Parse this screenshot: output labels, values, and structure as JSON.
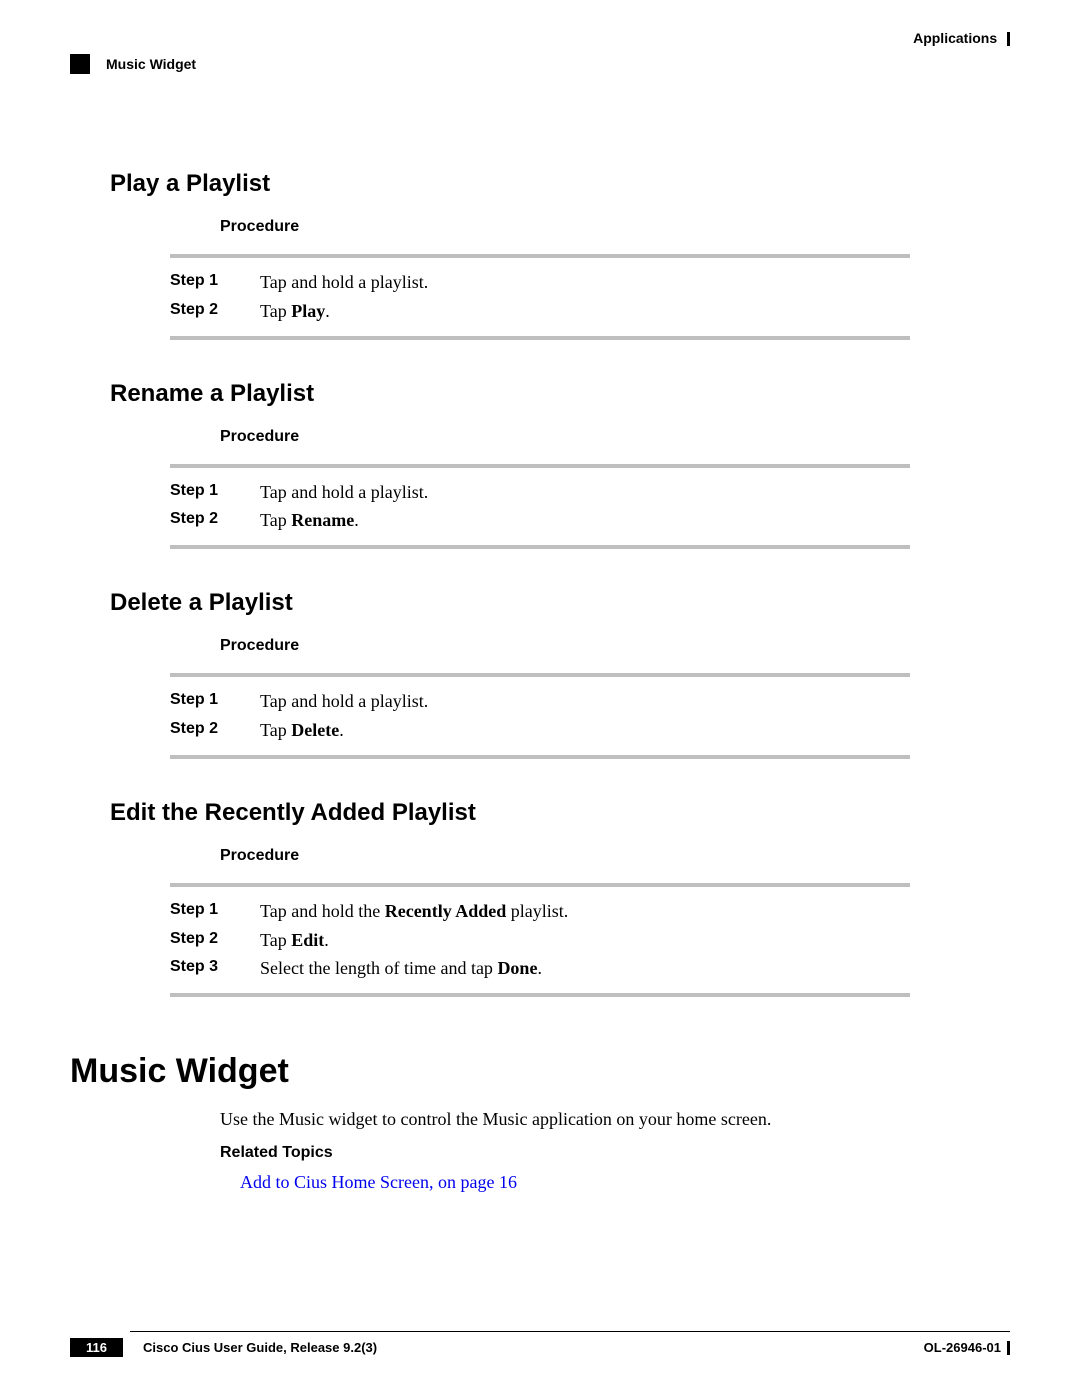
{
  "header": {
    "chapter": "Applications",
    "breadcrumb": "Music Widget"
  },
  "sections": [
    {
      "title": "Play a Playlist",
      "procedure_label": "Procedure",
      "steps": [
        {
          "label": "Step 1",
          "pre": "Tap and hold a playlist.",
          "bold": "",
          "post": ""
        },
        {
          "label": "Step 2",
          "pre": "Tap ",
          "bold": "Play",
          "post": "."
        }
      ]
    },
    {
      "title": "Rename a Playlist",
      "procedure_label": "Procedure",
      "steps": [
        {
          "label": "Step 1",
          "pre": "Tap and hold a playlist.",
          "bold": "",
          "post": ""
        },
        {
          "label": "Step 2",
          "pre": "Tap ",
          "bold": "Rename",
          "post": "."
        }
      ]
    },
    {
      "title": "Delete a Playlist",
      "procedure_label": "Procedure",
      "steps": [
        {
          "label": "Step 1",
          "pre": "Tap and hold a playlist.",
          "bold": "",
          "post": ""
        },
        {
          "label": "Step 2",
          "pre": "Tap ",
          "bold": "Delete",
          "post": "."
        }
      ]
    },
    {
      "title": "Edit the Recently Added Playlist",
      "procedure_label": "Procedure",
      "steps": [
        {
          "label": "Step 1",
          "pre": "Tap and hold the ",
          "bold": "Recently Added",
          "post": " playlist."
        },
        {
          "label": "Step 2",
          "pre": "Tap ",
          "bold": "Edit",
          "post": "."
        },
        {
          "label": "Step 3",
          "pre": "Select the length of time and tap ",
          "bold": "Done",
          "post": "."
        }
      ]
    }
  ],
  "widget": {
    "heading": "Music Widget",
    "body": "Use the Music widget to control the Music application on your home screen.",
    "related_label": "Related Topics",
    "link_text": "Add to Cius Home Screen,  on page 16"
  },
  "footer": {
    "page": "116",
    "doc_title": "Cisco Cius User Guide, Release 9.2(3)",
    "doc_id": "OL-26946-01"
  }
}
